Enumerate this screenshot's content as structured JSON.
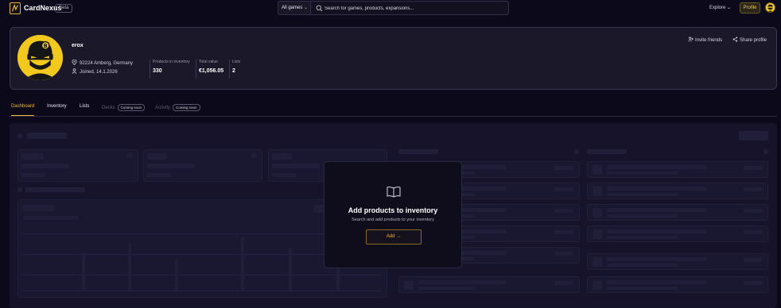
{
  "topbar": {
    "brand": "CardNexus",
    "beta_label": "Beta",
    "game_select": "All games",
    "search_placeholder": "Search for games, products, expansions...",
    "explore_label": "Explore",
    "profile_label": "Profile"
  },
  "profile": {
    "username": "erox",
    "location": "92224 Amberg, Germany",
    "joined": "Joined, 14.1.2026",
    "stats": [
      {
        "label": "Products in inventory",
        "value": "330"
      },
      {
        "label": "Total value",
        "value": "€1,056.05"
      },
      {
        "label": "Lists",
        "value": "2"
      }
    ],
    "invite_label": "Invite friends",
    "share_label": "Share profile"
  },
  "tabs": [
    {
      "label": "Dashboard",
      "state": "active"
    },
    {
      "label": "Inventory",
      "state": "normal"
    },
    {
      "label": "Lists",
      "state": "normal"
    },
    {
      "label": "Decks",
      "state": "disabled",
      "badge": "Coming soon"
    },
    {
      "label": "Activity",
      "state": "disabled",
      "badge": "Coming soon"
    }
  ],
  "empty_state": {
    "title": "Add products to inventory",
    "subtitle": "Search and add products to your inventory",
    "button": "Add →"
  },
  "colors": {
    "accent": "#f0b534",
    "background": "#0c0a1a",
    "card": "#1b1829",
    "avatar": "#f0c81e"
  },
  "icons": [
    "logo-icon",
    "chevron-down-icon",
    "search-icon",
    "location-pin-icon",
    "user-icon",
    "add-user-icon",
    "share-icon",
    "book-icon"
  ]
}
